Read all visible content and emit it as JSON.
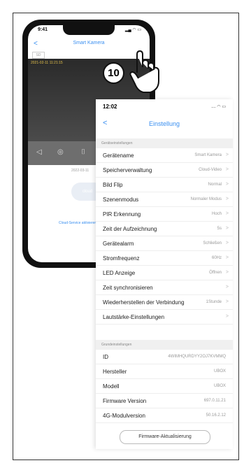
{
  "phone": {
    "time": "9:41",
    "title": "Smart Kamera",
    "timestamp": "2021-02-11 11:21:15",
    "date_nav": "2022-03-11",
    "cloud_label": "cloud",
    "cloud_service": "Cloud-Service aktivieren"
  },
  "callout": "10",
  "panel": {
    "time": "12:02",
    "title": "Einstellung",
    "section_device": "Gerätseinstellungen",
    "section_basic": "Grundeinstellungen",
    "rows": [
      {
        "label": "Gerätename",
        "value": "Smart Kamera"
      },
      {
        "label": "Speicherverwaltung",
        "value": "Cloud-Video"
      },
      {
        "label": "Bild Flip",
        "value": "Normal"
      },
      {
        "label": "Szenenmodus",
        "value": "Normaler Modus"
      },
      {
        "label": "PIR Erkennung",
        "value": "Hoch"
      },
      {
        "label": "Zeit der Aufzeichnung",
        "value": "5s"
      },
      {
        "label": "Gerätealarm",
        "value": "Schließen"
      },
      {
        "label": "Stromfrequenz",
        "value": "60Hz"
      },
      {
        "label": "LED Anzeige",
        "value": "Öffnen"
      },
      {
        "label": "Zeit synchronisieren",
        "value": ""
      },
      {
        "label": "Wiederherstellen der Verbindung",
        "value": "1Stunde"
      },
      {
        "label": "Lautstärke-Einstellungen",
        "value": ""
      }
    ],
    "info": [
      {
        "label": "ID",
        "value": "4WIMHQURDYY2OJ7KVMMQ"
      },
      {
        "label": "Hersteller",
        "value": "UBOX"
      },
      {
        "label": "Modell",
        "value": "UBOX"
      },
      {
        "label": "Firmware Version",
        "value": "697.0.11.21"
      },
      {
        "label": "4G-Modulversion",
        "value": "50.16.2.12"
      }
    ],
    "firmware_button": "Firmware-Aktualisierung"
  }
}
